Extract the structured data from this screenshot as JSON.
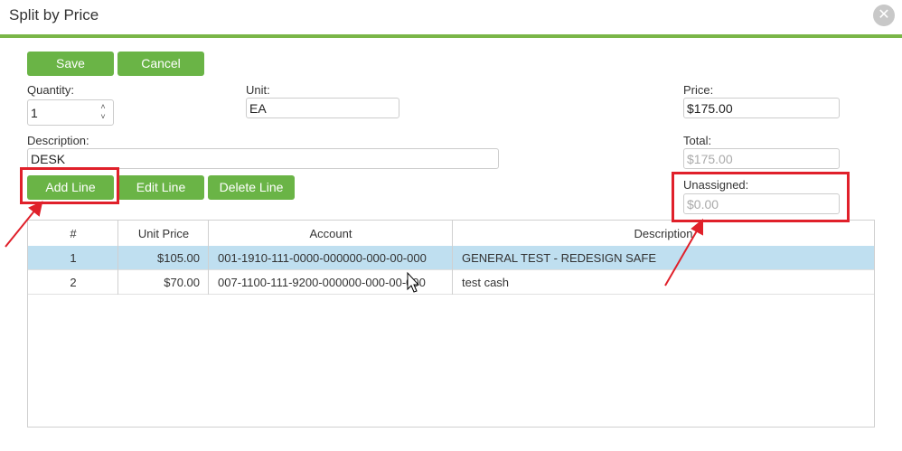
{
  "window": {
    "title": "Split by Price",
    "close_glyph": "✕"
  },
  "toolbar": {
    "save_label": "Save",
    "cancel_label": "Cancel"
  },
  "form": {
    "quantity_label": "Quantity:",
    "quantity_value": "1",
    "unit_label": "Unit:",
    "unit_value": "EA",
    "price_label": "Price:",
    "price_value": "$175.00",
    "description_label": "Description:",
    "description_value": "DESK",
    "total_label": "Total:",
    "total_value": "$175.00",
    "unassigned_label": "Unassigned:",
    "unassigned_value": "$0.00"
  },
  "line_actions": {
    "add_label": "Add Line",
    "edit_label": "Edit Line",
    "delete_label": "Delete Line"
  },
  "grid": {
    "columns": [
      "#",
      "Unit Price",
      "Account",
      "Description"
    ],
    "rows": [
      {
        "num": "1",
        "unit_price": "$105.00",
        "account": "001-1910-111-0000-000000-000-00-000",
        "description": "GENERAL TEST - REDESIGN SAFE",
        "selected": true
      },
      {
        "num": "2",
        "unit_price": "$70.00",
        "account": "007-1100-111-9200-000000-000-00-000",
        "description": "test cash",
        "selected": false
      }
    ]
  },
  "colors": {
    "accent_green": "#6ab446",
    "annotation_red": "#e0202a",
    "selected_row": "#bfdff0"
  }
}
